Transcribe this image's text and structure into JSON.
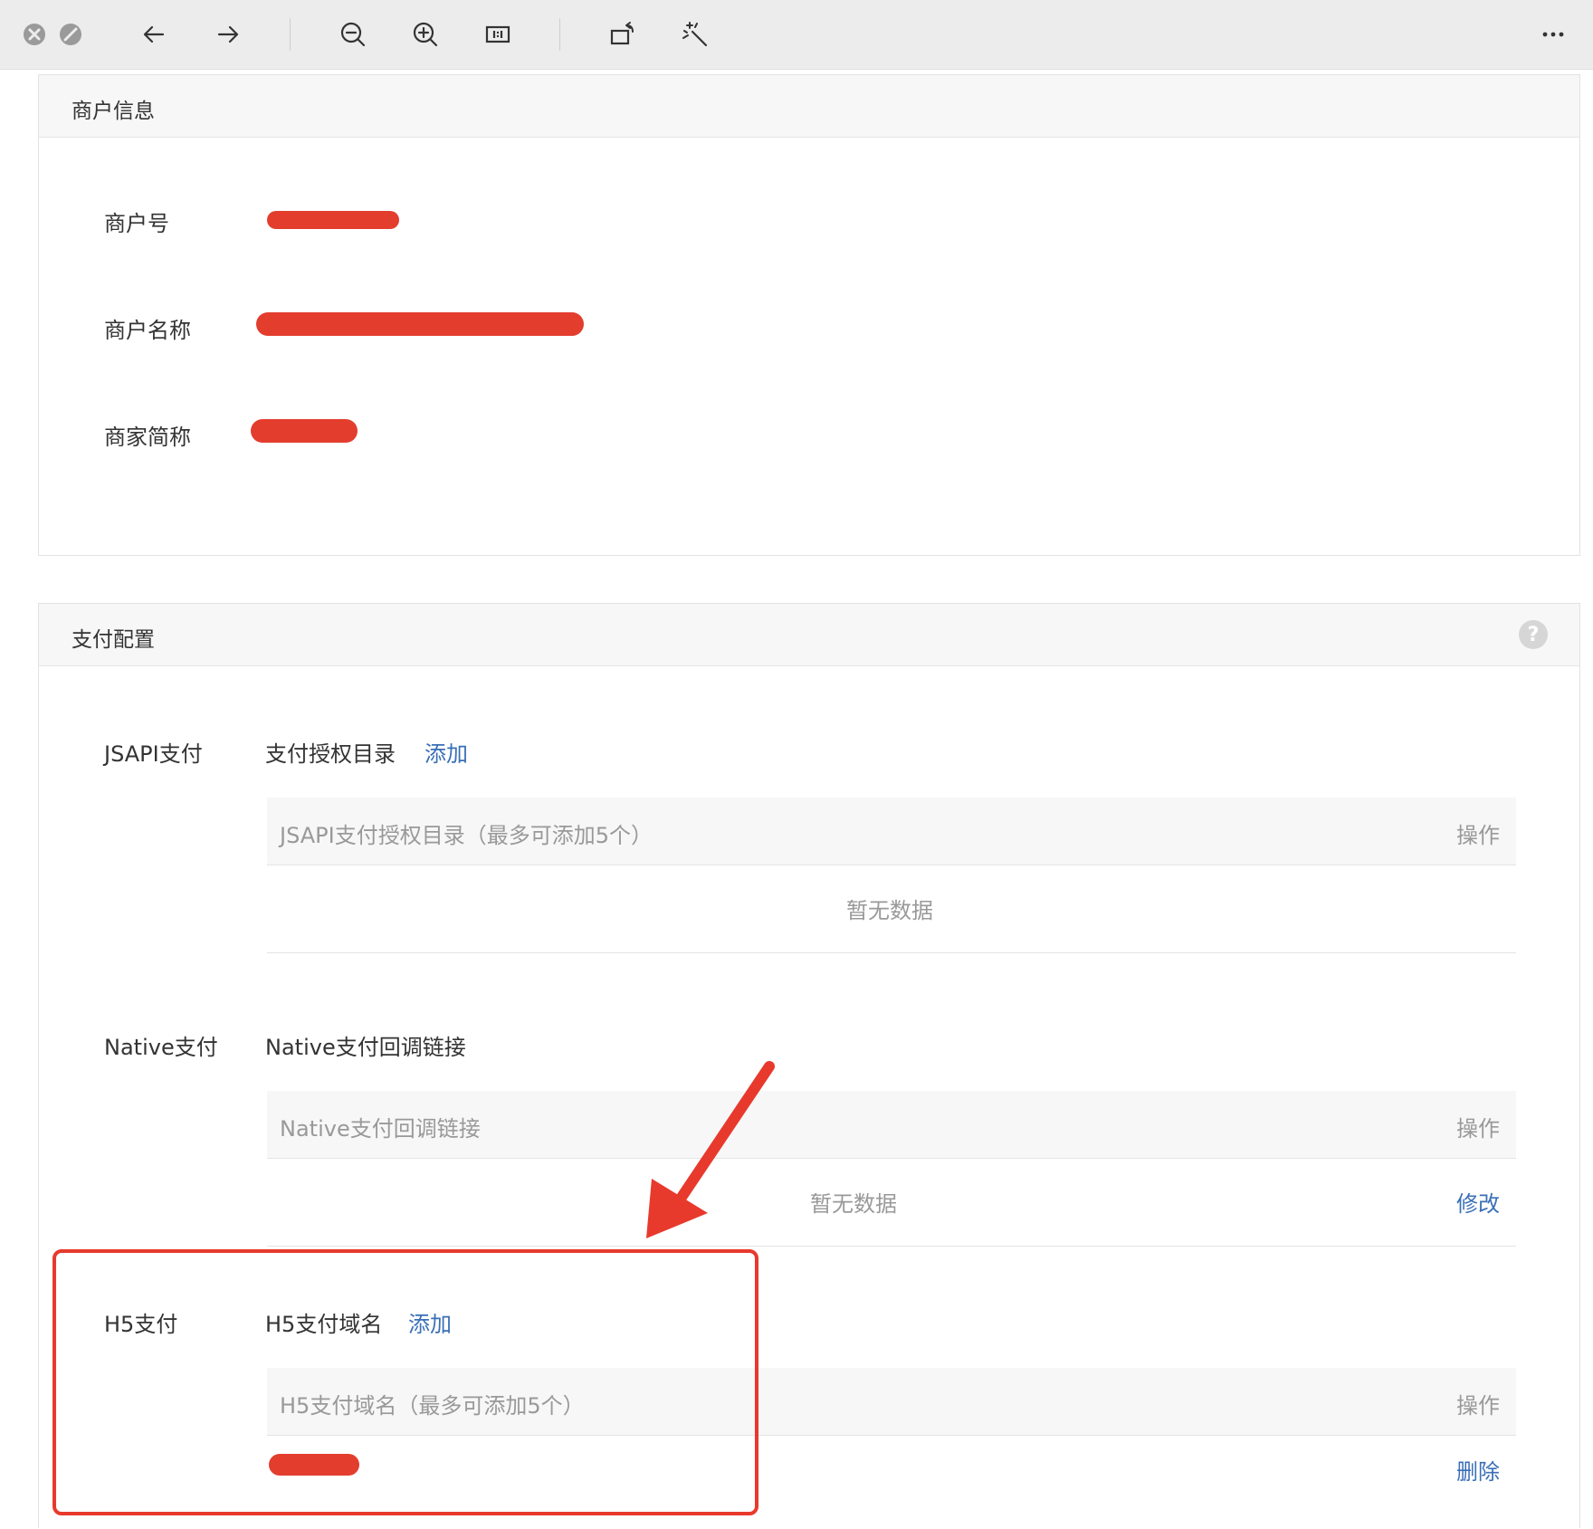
{
  "toolbar": {
    "icons": [
      "close-icon",
      "minimize-icon",
      "back-arrow-icon",
      "forward-arrow-icon",
      "zoom-out-icon",
      "zoom-in-icon",
      "actual-size-icon",
      "rotate-icon",
      "magic-wand-icon",
      "more-icon"
    ]
  },
  "merchant_info": {
    "title": "商户信息",
    "fields": [
      {
        "label": "商户号",
        "value": ""
      },
      {
        "label": "商户名称",
        "value": ""
      },
      {
        "label": "商家简称",
        "value": ""
      }
    ]
  },
  "payment_config": {
    "title": "支付配置",
    "help": "?",
    "jsapi": {
      "label": "JSAPI支付",
      "sub_label": "支付授权目录",
      "add_link": "添加",
      "table_header": "JSAPI支付授权目录（最多可添加5个）",
      "op_header": "操作",
      "empty_text": "暂无数据"
    },
    "native": {
      "label": "Native支付",
      "sub_label": "Native支付回调链接",
      "table_header": "Native支付回调链接",
      "op_header": "操作",
      "empty_text": "暂无数据",
      "edit_link": "修改"
    },
    "h5": {
      "label": "H5支付",
      "sub_label": "H5支付域名",
      "add_link": "添加",
      "table_header": "H5支付域名（最多可添加5个）",
      "op_header": "操作",
      "delete_link": "删除"
    }
  },
  "colors": {
    "link": "#3a6fb7",
    "annotation": "#e8392d",
    "header_bg": "#f7f7f7"
  }
}
